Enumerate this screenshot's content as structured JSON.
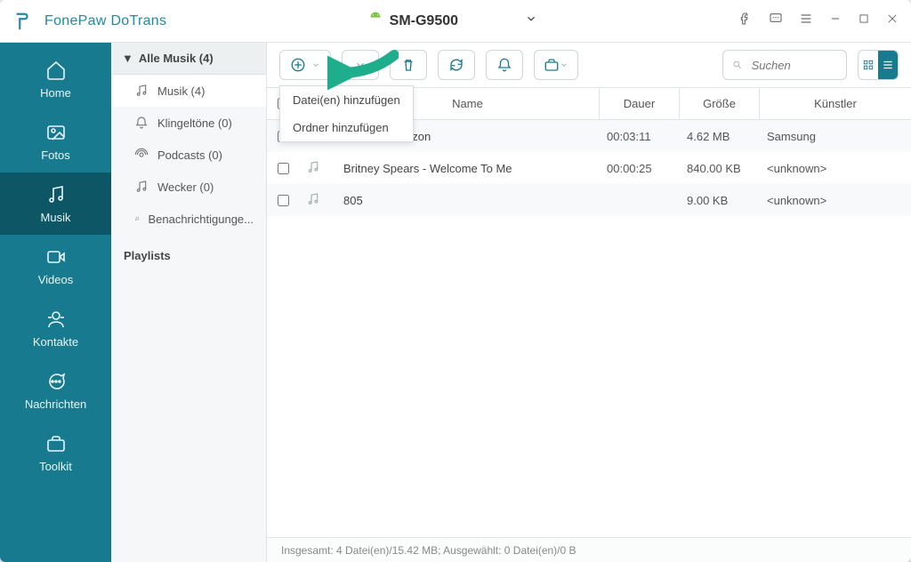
{
  "app": {
    "title": "FonePaw DoTrans"
  },
  "device": {
    "name": "SM-G9500"
  },
  "nav": {
    "items": [
      {
        "label": "Home"
      },
      {
        "label": "Fotos"
      },
      {
        "label": "Musik"
      },
      {
        "label": "Videos"
      },
      {
        "label": "Kontakte"
      },
      {
        "label": "Nachrichten"
      },
      {
        "label": "Toolkit"
      }
    ],
    "active_index": 2
  },
  "categories": {
    "head": "Alle Musik (4)",
    "items": [
      {
        "label": "Musik (4)"
      },
      {
        "label": "Klingeltöne (0)"
      },
      {
        "label": "Podcasts (0)"
      },
      {
        "label": "Wecker (0)"
      },
      {
        "label": "Benachrichtigunge..."
      }
    ],
    "playlists_head": "Playlists"
  },
  "dropdown": {
    "item1": "Datei(en) hinzufügen",
    "item2": "Ordner hinzufügen"
  },
  "search": {
    "placeholder": "Suchen"
  },
  "table": {
    "head": {
      "name": "Name",
      "duration": "Dauer",
      "size": "Größe",
      "artist": "Künstler"
    },
    "rows": [
      {
        "name": "Over the Horizon",
        "duration": "00:03:11",
        "size": "4.62 MB",
        "artist": "Samsung"
      },
      {
        "name": "Britney Spears - Welcome To Me",
        "duration": "00:00:25",
        "size": "840.00 KB",
        "artist": "<unknown>"
      },
      {
        "name": "805",
        "duration": "",
        "size": "9.00 KB",
        "artist": "<unknown>"
      }
    ]
  },
  "status": {
    "text": "Insgesamt: 4 Datei(en)/15.42 MB; Ausgewählt: 0 Datei(en)/0 B"
  }
}
